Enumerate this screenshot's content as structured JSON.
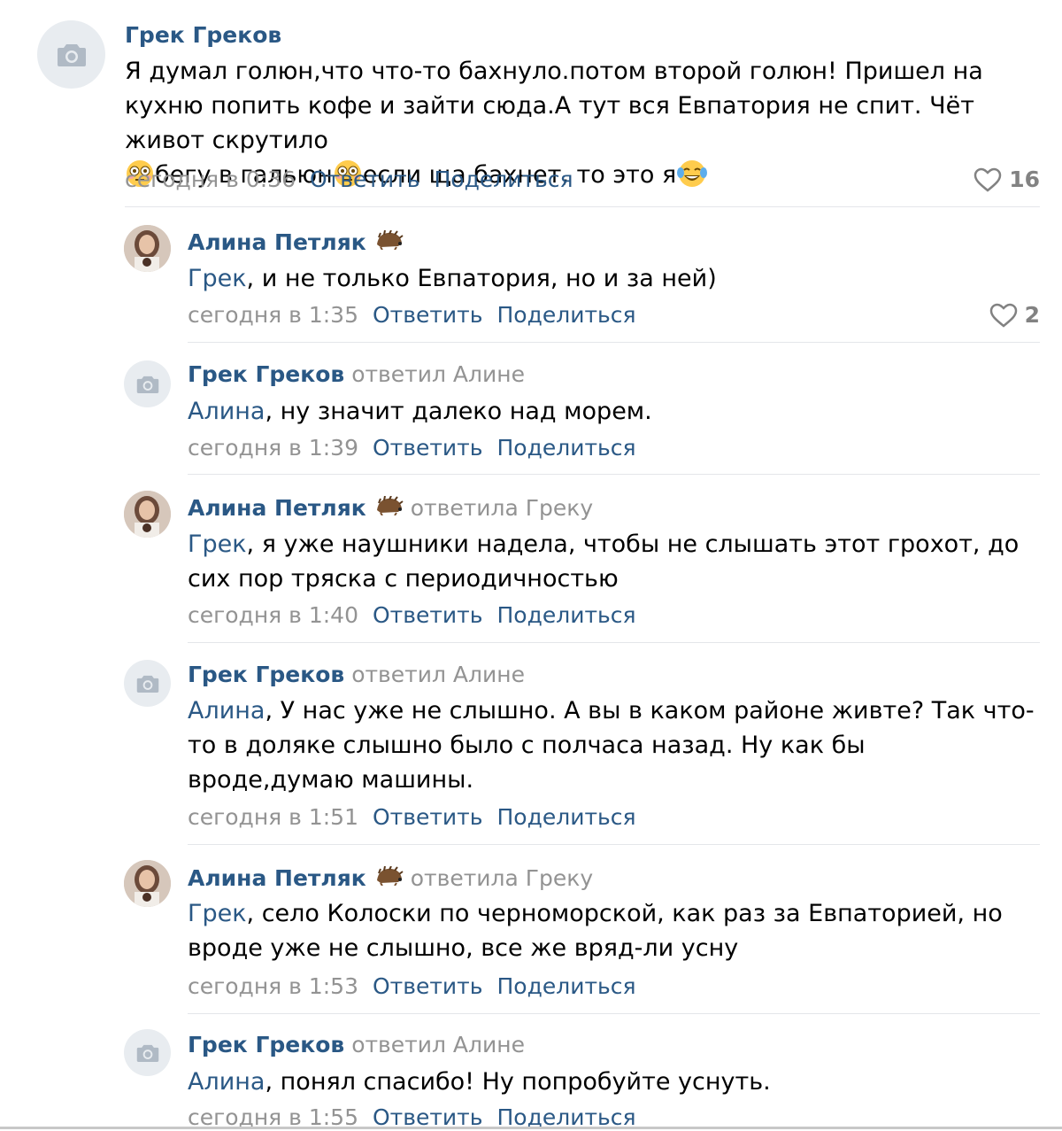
{
  "comments": [
    {
      "author": "Грек Греков",
      "reply_to": "",
      "mention": "",
      "text": "Я думал голюн,что что-то бахнуло.потом второй голюн! Пришел на кухню попить кофе и зайти сюда.А тут вся Евпатория не спит. Чёт живот скрутило",
      "text_2": "бегу в гальюн",
      "text_3": "если ща бахнет, то это я",
      "time": "сегодня в 0:36",
      "reply_label": "Ответить",
      "share_label": "Поделиться",
      "likes": "16"
    },
    {
      "author": "Алина Петляк",
      "reply_to": "",
      "mention": "Грек",
      "text": ", и не только Евпатория, но и за ней)",
      "time": "сегодня в 1:35",
      "reply_label": "Ответить",
      "share_label": "Поделиться",
      "likes": "2"
    },
    {
      "author": "Грек Греков",
      "reply_to": "ответил Алине",
      "mention": "Алина",
      "text": ", ну значит далеко над морем.",
      "time": "сегодня в 1:39",
      "reply_label": "Ответить",
      "share_label": "Поделиться"
    },
    {
      "author": "Алина Петляк",
      "reply_to": "ответила Греку",
      "mention": "Грек",
      "text": ", я уже наушники надела, чтобы не слышать этот грохот, до сих пор тряска с периодичностью",
      "time": "сегодня в 1:40",
      "reply_label": "Ответить",
      "share_label": "Поделиться"
    },
    {
      "author": "Грек Греков",
      "reply_to": "ответил Алине",
      "mention": "Алина",
      "text": ", У нас уже не слышно. А вы в каком районе живте? Так что-то в доляке слышно было с полчаса назад. Ну как бы вроде,думаю машины.",
      "time": "сегодня в 1:51",
      "reply_label": "Ответить",
      "share_label": "Поделиться"
    },
    {
      "author": "Алина Петляк",
      "reply_to": "ответила Греку",
      "mention": "Грек",
      "text": ", село Колоски по черноморской, как раз за Евпаторией, но вроде уже не слышно, все же вряд-ли усну",
      "time": "сегодня в 1:53",
      "reply_label": "Ответить",
      "share_label": "Поделиться"
    },
    {
      "author": "Грек Греков",
      "reply_to": "ответил Алине",
      "mention": "Алина",
      "text": ", понял спасибо! Ну попробуйте уснуть.",
      "time": "сегодня в 1:55",
      "reply_label": "Ответить",
      "share_label": "Поделиться"
    }
  ],
  "colors": {
    "link": "#2a5885",
    "muted": "#939393",
    "like": "#828282"
  },
  "icons": {
    "placeholder_avatar": "camera-icon",
    "like": "heart-outline-icon",
    "author_badge": "hedgehog-emoji",
    "emoji_1": "flushed-face-emoji",
    "emoji_2": "tears-of-joy-emoji"
  }
}
